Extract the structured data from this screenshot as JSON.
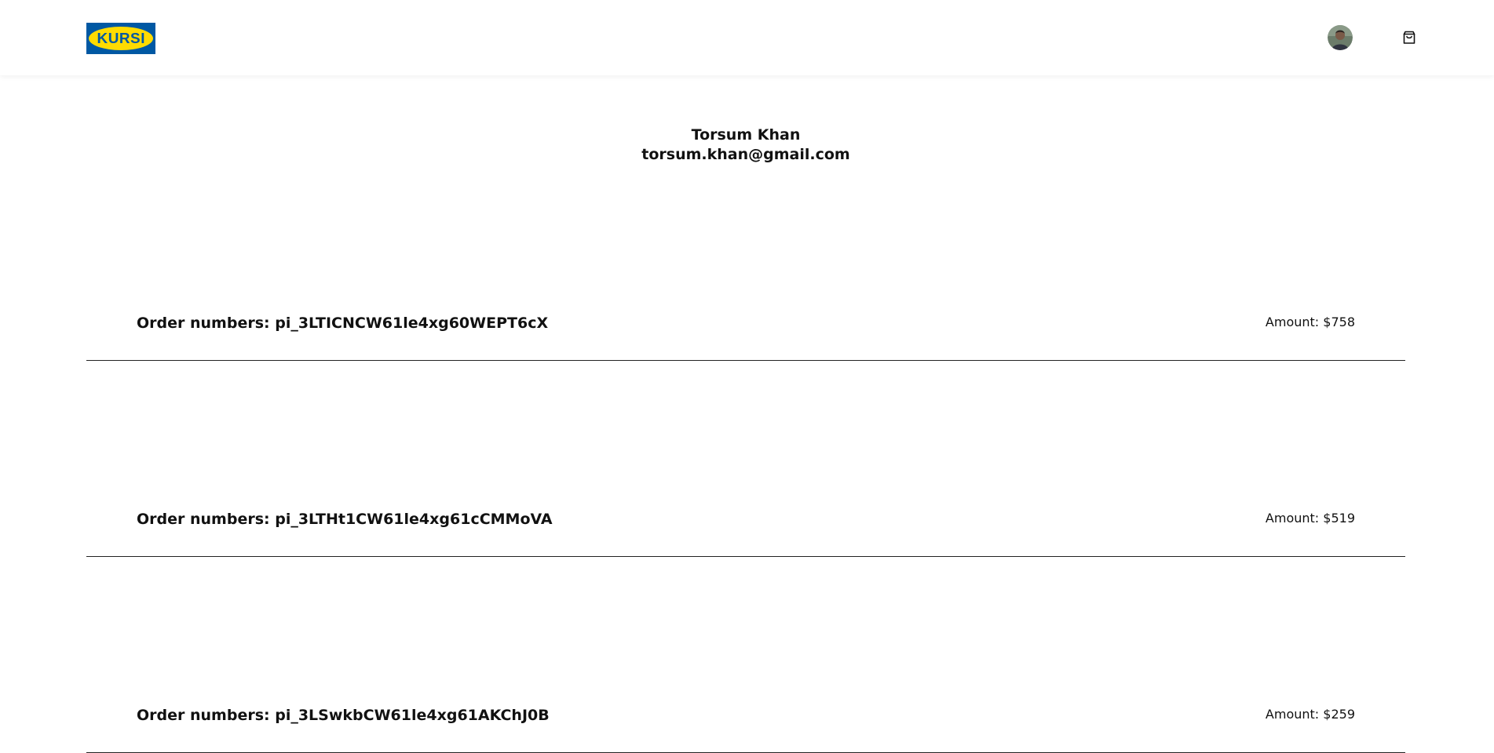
{
  "header": {
    "logo_text": "KURSI",
    "avatar_icon": "user-avatar",
    "cart_icon": "shopping-bag-icon",
    "brand_blue": "#0058a3",
    "brand_yellow": "#ffdb00"
  },
  "profile": {
    "name": "Torsum Khan",
    "email": "torsum.khan@gmail.com"
  },
  "orders": [
    {
      "label": "Order numbers: pi_3LTICNCW61le4xg60WEPT6cX",
      "amount": "Amount: $758"
    },
    {
      "label": "Order numbers: pi_3LTHt1CW61le4xg61cCMMoVA",
      "amount": "Amount: $519"
    },
    {
      "label": "Order numbers: pi_3LSwkbCW61le4xg61AKChJ0B",
      "amount": "Amount: $259"
    }
  ]
}
